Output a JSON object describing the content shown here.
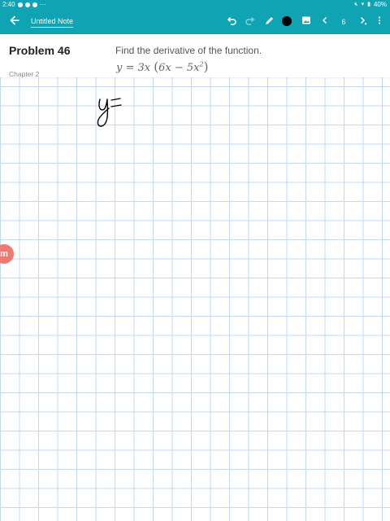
{
  "status_bar": {
    "time": "2:40",
    "battery": "40%",
    "more_indicator": "···"
  },
  "app_bar": {
    "title": "Untitled Note",
    "page_number": "6",
    "colors": {
      "bar": "#10a3b4",
      "pen_color": "#000000"
    }
  },
  "problem": {
    "title": "Problem 46",
    "chapter": "Chapter 2",
    "prompt": "Find the derivative of the function.",
    "formula": {
      "y": "y",
      "eq": " = 3x ",
      "inner": "6x − 5x",
      "exp": "2"
    }
  },
  "float_button": {
    "label": "m"
  }
}
